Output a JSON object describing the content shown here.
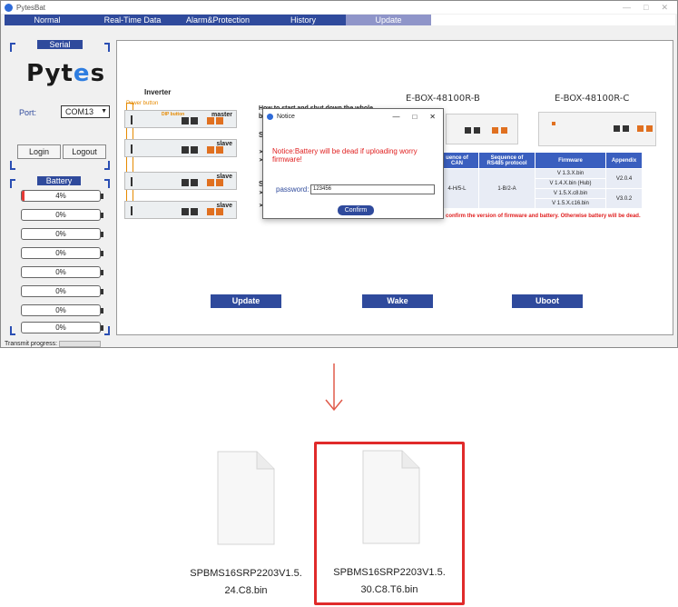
{
  "window": {
    "title": "PytesBat",
    "controls": [
      "—",
      "□",
      "✕"
    ]
  },
  "tabs": [
    {
      "label": "Normal",
      "active": false
    },
    {
      "label": "Real-Time Data",
      "active": false
    },
    {
      "label": "Alarm&Protection",
      "active": false
    },
    {
      "label": "History",
      "active": false
    },
    {
      "label": "Update",
      "active": true
    }
  ],
  "serial": {
    "header": "Serial",
    "logo_prefix": "Pyt",
    "logo_e": "e",
    "logo_suffix": "s",
    "port_label": "Port:",
    "port_value": "COM13",
    "login_label": "Login",
    "logout_label": "Logout"
  },
  "battery": {
    "header": "Battery",
    "rows": [
      {
        "value": "4%",
        "fill": 0.04
      },
      {
        "value": "0%",
        "fill": 0
      },
      {
        "value": "0%",
        "fill": 0
      },
      {
        "value": "0%",
        "fill": 0
      },
      {
        "value": "0%",
        "fill": 0
      },
      {
        "value": "0%",
        "fill": 0
      },
      {
        "value": "0%",
        "fill": 0
      },
      {
        "value": "0%",
        "fill": 0
      }
    ]
  },
  "main": {
    "inverter_label": "Inverter",
    "power_button_label": "Power button",
    "dip_button_label": "DIP button",
    "units": [
      "master",
      "slave",
      "slave",
      "slave"
    ],
    "howto_title": "How to start and shut down the whole battery correctly:",
    "fragments": {
      "sta": "Sta",
      "start_steps": [
        "➢ S",
        "➢ S"
      ],
      "start_extra": "s",
      "shu": "Shu",
      "stop_steps": [
        "➢ S",
        "s",
        "➢ S"
      ]
    },
    "ebox_b": "E-BOX-48100R-B",
    "ebox_c": "E-BOX-48100R-C",
    "table": {
      "headers": [
        "Sequence of CAN protocol",
        "Sequence of RS485 protocol",
        "Firmware",
        "Appendix"
      ],
      "header_cut": "uence of CAN",
      "rows": [
        {
          "can": "4-H/5-L",
          "rs485": "1-B/2-A",
          "firmware": [
            "V 1.3.X.bin",
            "V 1.4.X.bin (Hub)"
          ],
          "appendix": "V2.0.4"
        },
        {
          "can": "",
          "rs485": "",
          "firmware": [
            "V 1.5.X.c8.bin",
            "V 1.5.X.c16.bin"
          ],
          "appendix": "V3.0.2"
        }
      ]
    },
    "warning": "confirm the version of firmware and battery. Otherwise battery will be dead.",
    "buttons": {
      "update": "Update",
      "wake": "Wake",
      "uboot": "Uboot"
    }
  },
  "dialog": {
    "title": "Notice",
    "warning": "Notice:Battery will be dead if uploading worry firmware!",
    "password_label": "password:",
    "password_value": "123456",
    "confirm_label": "Confirm"
  },
  "status": {
    "progress_label": "Transmit progress:",
    "progress": 0
  },
  "files": [
    {
      "name_line1": "SPBMS16SRP2203V1.5.",
      "name_line2": "24.C8.bin",
      "selected": false
    },
    {
      "name_line1": "SPBMS16SRP2203V1.5.",
      "name_line2": "30.C8.T6.bin",
      "selected": true
    }
  ],
  "colors": {
    "accent": "#2f4a9c",
    "tab_active": "#8f95c9",
    "warning": "#e02020",
    "selection": "#e02a2a"
  }
}
